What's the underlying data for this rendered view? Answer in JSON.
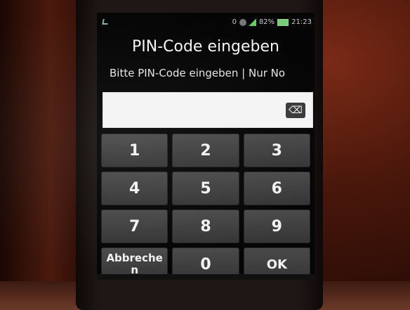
{
  "status_bar": {
    "notification_count": "0",
    "battery_percent": "82%",
    "time": "21:23"
  },
  "dialog": {
    "title": "PIN-Code eingeben",
    "subtitle": "Bitte PIN-Code eingeben | Nur No",
    "pin_value": ""
  },
  "keypad": {
    "keys": [
      "1",
      "2",
      "3",
      "4",
      "5",
      "6",
      "7",
      "8",
      "9",
      "Abbrechen",
      "0",
      "OK"
    ]
  },
  "colors": {
    "screen_background": "#050505",
    "key_background": "#3f3f3f",
    "text": "#f2f2f2",
    "input_background": "#f4f4f4"
  },
  "icons": {
    "backspace": "backspace-icon",
    "battery": "battery-icon",
    "signal": "signal-icon"
  }
}
